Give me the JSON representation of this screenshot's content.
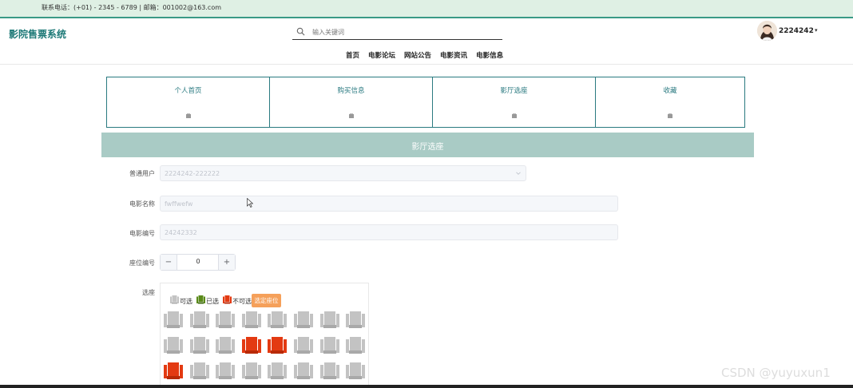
{
  "topbar": {
    "contact": "联系电话：(+01) - 2345 - 6789 | 邮箱：001002@163.com"
  },
  "header": {
    "brand": "影院售票系统",
    "search_placeholder": "输入关键词",
    "nav": [
      "首页",
      "电影论坛",
      "网站公告",
      "电影资讯",
      "电影信息"
    ],
    "username": "2224242",
    "caret": "▾"
  },
  "tabs": [
    {
      "label": "个人首页",
      "icon": "image-placeholder-icon"
    },
    {
      "label": "购买信息",
      "icon": "image-placeholder-icon"
    },
    {
      "label": "影厅选座",
      "icon": "image-placeholder-icon"
    },
    {
      "label": "收藏",
      "icon": "image-placeholder-icon"
    }
  ],
  "section": {
    "title": "影厅选座"
  },
  "form": {
    "user_label": "普通用户",
    "user_value": "2224242-222222",
    "movie_name_label": "电影名称",
    "movie_name_value": "fwffwefw",
    "movie_no_label": "电影编号",
    "movie_no_value": "24242332",
    "seat_no_label": "座位编号",
    "seat_no_value": "0",
    "stepper_minus": "−",
    "stepper_plus": "+",
    "choose_label": "选座"
  },
  "legend": {
    "available": "可选",
    "selected": "已选",
    "unavailable": "不可选",
    "button": "选定座位"
  },
  "colors": {
    "available": "#c3c3c3",
    "selected": "#5a8a1a",
    "unavailable": "#e33a12",
    "accent": "#2a7a80",
    "topbar": "#dff0e4",
    "section": "#a9cbc5"
  },
  "seats": [
    [
      "available",
      "available",
      "available",
      "available",
      "available",
      "available",
      "available",
      "available"
    ],
    [
      "available",
      "available",
      "available",
      "unavailable",
      "unavailable",
      "available",
      "available",
      "available"
    ],
    [
      "unavailable",
      "available",
      "available",
      "available",
      "available",
      "available",
      "available",
      "available"
    ]
  ],
  "watermark": "CSDN @yuyuxun1"
}
